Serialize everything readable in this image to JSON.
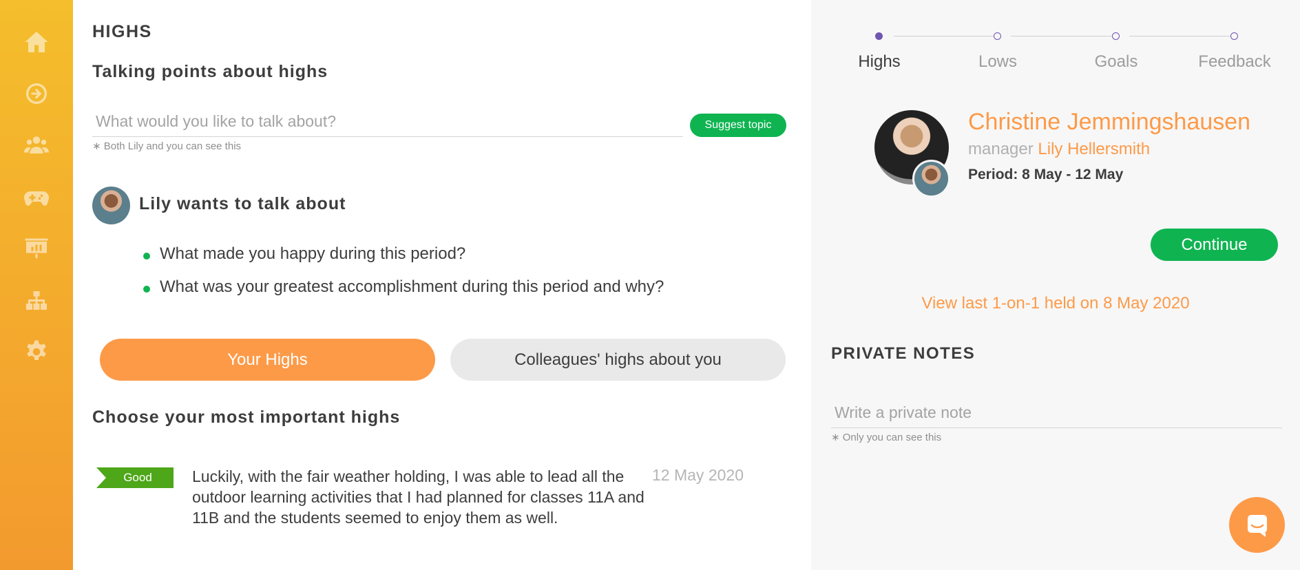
{
  "sidebar": {
    "items": [
      {
        "icon": "home-icon"
      },
      {
        "icon": "arrow-circle-icon"
      },
      {
        "icon": "people-icon"
      },
      {
        "icon": "gamepad-icon"
      },
      {
        "icon": "presentation-icon"
      },
      {
        "icon": "org-chart-icon"
      },
      {
        "icon": "gear-icon"
      }
    ]
  },
  "main": {
    "section_title": "HIGHS",
    "talking_points_title": "Talking points about highs",
    "topic_placeholder": "What would you like to talk about?",
    "suggest_button": "Suggest topic",
    "topic_hint": "∗ Both Lily and you can see this",
    "lily_title": "Lily wants to talk about",
    "lily_topics": [
      "What made you happy during this period?",
      "What was your greatest accomplishment during this period and why?"
    ],
    "tabs": [
      {
        "label": "Your Highs",
        "active": true
      },
      {
        "label": "Colleagues' highs about you",
        "active": false
      }
    ],
    "choose_title": "Choose your most important highs",
    "highs": [
      {
        "tag": "Good",
        "text": "Luckily, with the fair weather holding, I was able to lead all the outdoor learning activities that I had planned for classes 11A and 11B and the students seemed to enjoy them as well.",
        "date": "12 May 2020"
      }
    ]
  },
  "right": {
    "steps": [
      {
        "label": "Highs",
        "active": true
      },
      {
        "label": "Lows",
        "active": false
      },
      {
        "label": "Goals",
        "active": false
      },
      {
        "label": "Feedback",
        "active": false
      }
    ],
    "person_name": "Christine Jemmingshausen",
    "manager_label": "manager",
    "manager_name": "Lily Hellersmith",
    "period": "Period: 8 May - 12 May",
    "continue_button": "Continue",
    "view_last": "View last 1-on-1 held on 8 May 2020",
    "private_notes_title": "PRIVATE NOTES",
    "note_placeholder": "Write a private note",
    "note_hint": "∗ Only you can see this"
  },
  "colors": {
    "accent_orange": "#fd9a48",
    "green": "#0fb451",
    "tag_green": "#4ea619",
    "step_purple": "#6f56b0",
    "sidebar_top": "#f4be2c",
    "sidebar_bottom": "#f39a2e"
  }
}
